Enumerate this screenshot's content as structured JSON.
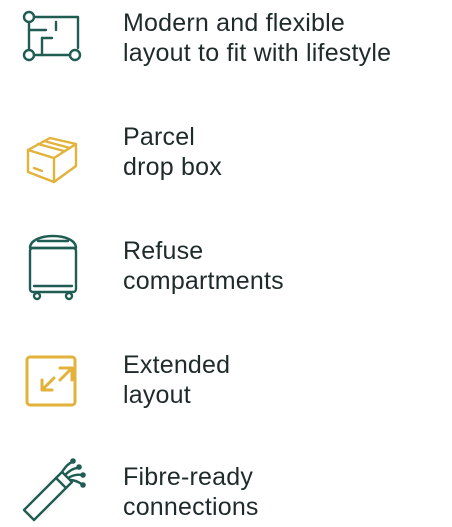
{
  "colors": {
    "teal": "#1f5c52",
    "gold": "#e2b23a",
    "text": "#1f2a2a"
  },
  "features": [
    {
      "icon": "floor-plan-icon",
      "line1": "Modern and flexible",
      "line2": "layout to fit with lifestyle"
    },
    {
      "icon": "parcel-box-icon",
      "line1": "Parcel",
      "line2": "drop box"
    },
    {
      "icon": "refuse-bin-icon",
      "line1": "Refuse",
      "line2": "compartments"
    },
    {
      "icon": "expand-arrows-icon",
      "line1": "Extended",
      "line2": "layout"
    },
    {
      "icon": "fibre-cable-icon",
      "line1": "Fibre-ready",
      "line2": "connections"
    }
  ]
}
